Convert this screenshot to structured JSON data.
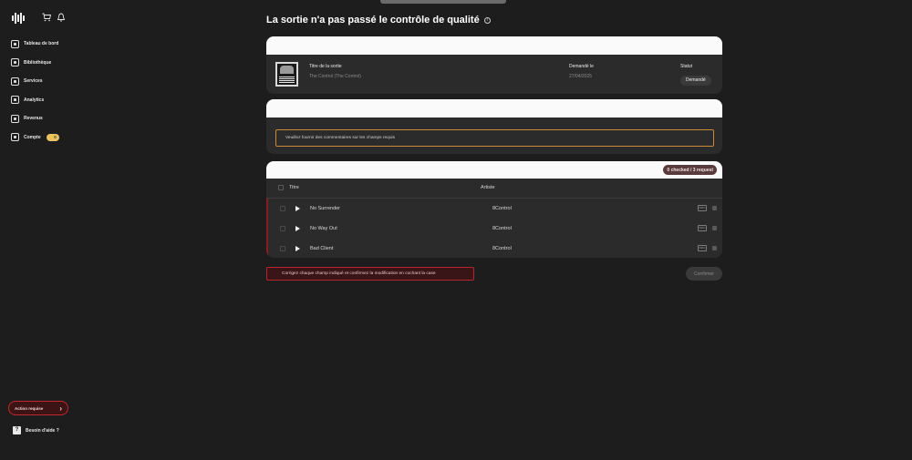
{
  "app": {
    "logo": "waveform-logo",
    "accent_color": "#c0282e",
    "warning_color": "#c98a3a"
  },
  "header": {
    "icons": [
      "cart-icon",
      "bell-icon"
    ]
  },
  "sidebar": {
    "items": [
      {
        "label": "Tableau de bord",
        "icon": "home-icon"
      },
      {
        "label": "Bibliothèque",
        "icon": "library-icon"
      },
      {
        "label": "Services",
        "icon": "services-icon"
      },
      {
        "label": "Analytics",
        "icon": "analytics-icon"
      },
      {
        "label": "Revenus",
        "icon": "revenue-icon"
      },
      {
        "label": "Compte",
        "icon": "account-icon",
        "badge": "⚡0"
      }
    ],
    "action_required": "Action requise",
    "help": "Besoin d'aide ?"
  },
  "main": {
    "title": "La sortie n'a pas passé le contrôle de qualité",
    "release": {
      "title_label": "Titre de la sortie",
      "title_value": "The Control (The Control)",
      "requested_label": "Demandé le",
      "requested_value": "27/04/2025",
      "status_label": "Statut",
      "status_value": "Demandé"
    },
    "comment_placeholder": "Veuillez fournir des commentaires sur les champs requis",
    "tracks": {
      "checked_label": "0 checked / 3 request",
      "col_title": "Titre",
      "col_artist": "Artiste",
      "rows": [
        {
          "title": "No Surrender",
          "artist": "8Control"
        },
        {
          "title": "No Way Out",
          "artist": "8Control"
        },
        {
          "title": "Bad Client",
          "artist": "8Control"
        }
      ]
    },
    "error_message": "Corrigez chaque champ indiqué et confirmez la modification en cochant la case",
    "confirm_label": "Confirmer"
  }
}
